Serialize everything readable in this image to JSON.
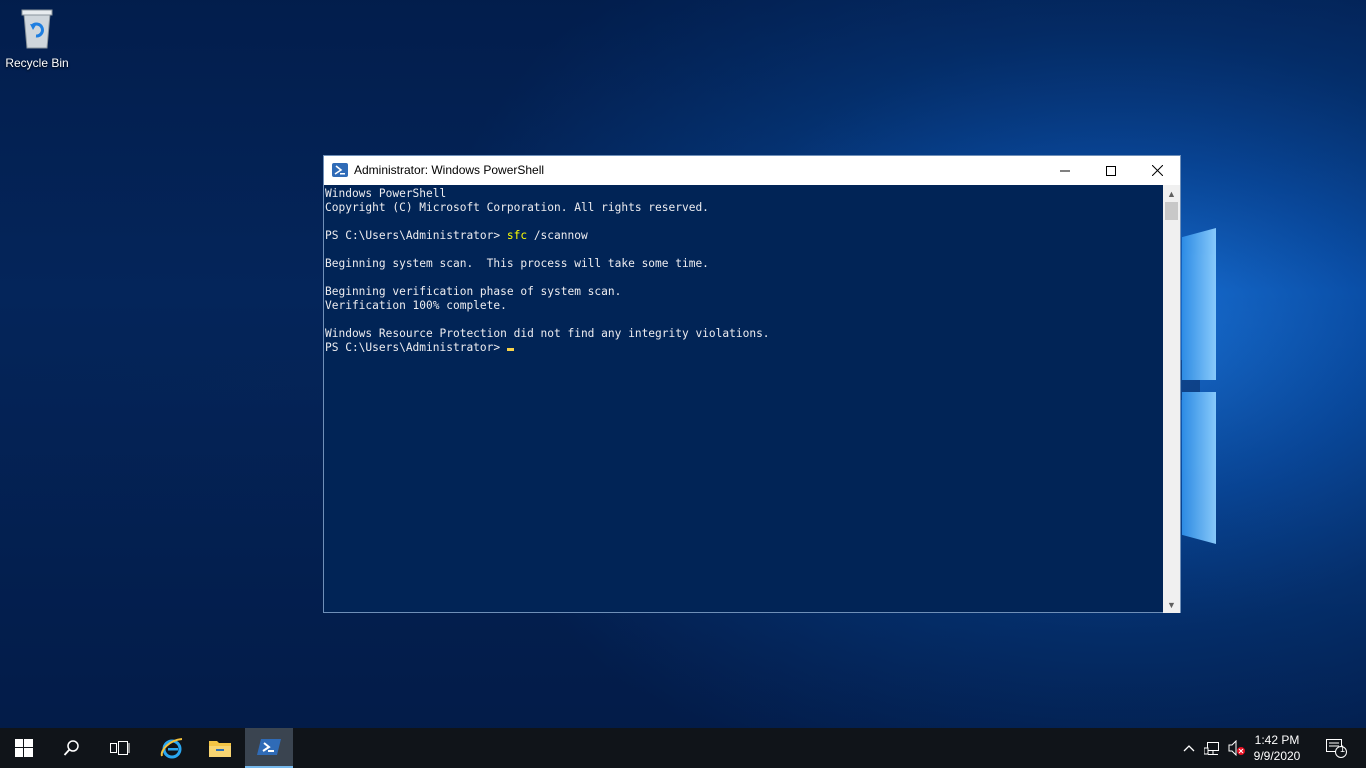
{
  "desktop": {
    "icons": [
      {
        "label": "Recycle Bin",
        "icon": "recycle-bin-icon"
      }
    ]
  },
  "window": {
    "title": "Administrator: Windows PowerShell",
    "icon": "powershell-icon",
    "console": {
      "line1": "Windows PowerShell",
      "line2": "Copyright (C) Microsoft Corporation. All rights reserved.",
      "prompt1": "PS C:\\Users\\Administrator> ",
      "cmd": "sfc",
      "cmd_args": " /scannow",
      "line4": "Beginning system scan.  This process will take some time.",
      "line5": "Beginning verification phase of system scan.",
      "line6": "Verification 100% complete.",
      "line7": "Windows Resource Protection did not find any integrity violations.",
      "prompt2": "PS C:\\Users\\Administrator> "
    },
    "colors": {
      "console_bg": "#012456",
      "text": "#eeedf0",
      "command": "#ffff00"
    }
  },
  "taskbar": {
    "items": [
      "start-icon",
      "search-icon",
      "task-view-icon",
      "internet-explorer-icon",
      "file-explorer-icon",
      "powershell-icon"
    ],
    "active": "powershell-icon",
    "clock": {
      "time": "1:42 PM",
      "date": "9/9/2020"
    },
    "notifications_count": "1"
  }
}
